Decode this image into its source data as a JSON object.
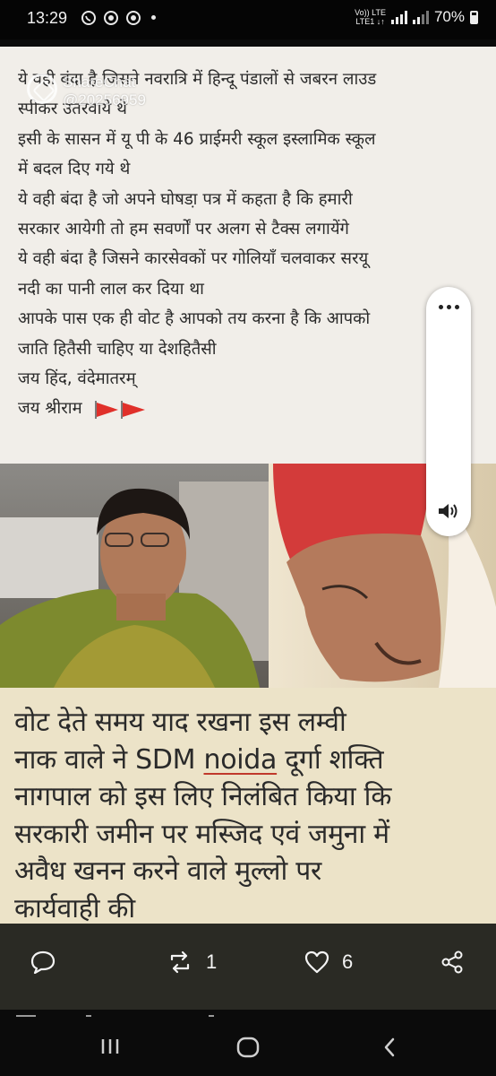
{
  "status_bar": {
    "time": "13:29",
    "network_top": "Vo)) LTE",
    "network_bottom": "LTE1 ↓↑",
    "battery": "70%",
    "icons": [
      "whatsapp-icon",
      "chrome-icon",
      "chrome-icon",
      "dot-icon"
    ]
  },
  "watermark": {
    "brand": "ShareChat",
    "handle": "@20256959"
  },
  "post_text": {
    "lines": [
      "ये वही बंदा है जिसने नवरात्रि में हिन्दू पंडालों से जबरन लाउड",
      "स्पीकर उतरवाये थे",
      "इसी के सासन में यू पी के 46 प्राईमरी स्कूल इस्लामिक स्कूल",
      "में बदल दिए गये थे",
      "ये वही बंदा है जो अपने घोषडा़ पत्र में कहता है कि हमारी",
      "सरकार आयेगी तो हम सवर्णों पर अलग से टैक्स लगायेंगे",
      "ये वही बंदा है जिसने कारसेवकों पर गोलियाँ चलवाकर सरयू",
      "नदी का पानी लाल कर दिया था",
      "आपके पास एक ही वोट है आपको तय करना है कि आपको",
      "जाति हितैसी चाहिए या देशहितैसी",
      "जय हिंद, वंदेमातरम्",
      "जय श्रीराम"
    ]
  },
  "caption": {
    "lines": [
      "वोट देते समय याद रखना इस लम्वी",
      "नाक वाले ने SDM ",
      "नागपाल को इस लिए निलंबित किया कि",
      "सरकारी जमीन पर मस्जिद एवं जमुना में",
      "अवैध खनन करने वाले मुल्लो पर",
      "कार्यवाही की"
    ],
    "line2_underlined": "noida",
    "line2_rest": " दूर्गा शक्ति"
  },
  "actions": {
    "comment_icon": "comment-icon",
    "repost_count": "1",
    "like_count": "6",
    "share_icon": "share-icon"
  },
  "colors": {
    "post_bg": "#f1eee9",
    "caption_bg": "#ece3c8",
    "action_bar": "#2a2a24",
    "flag_red": "#e0302a"
  }
}
